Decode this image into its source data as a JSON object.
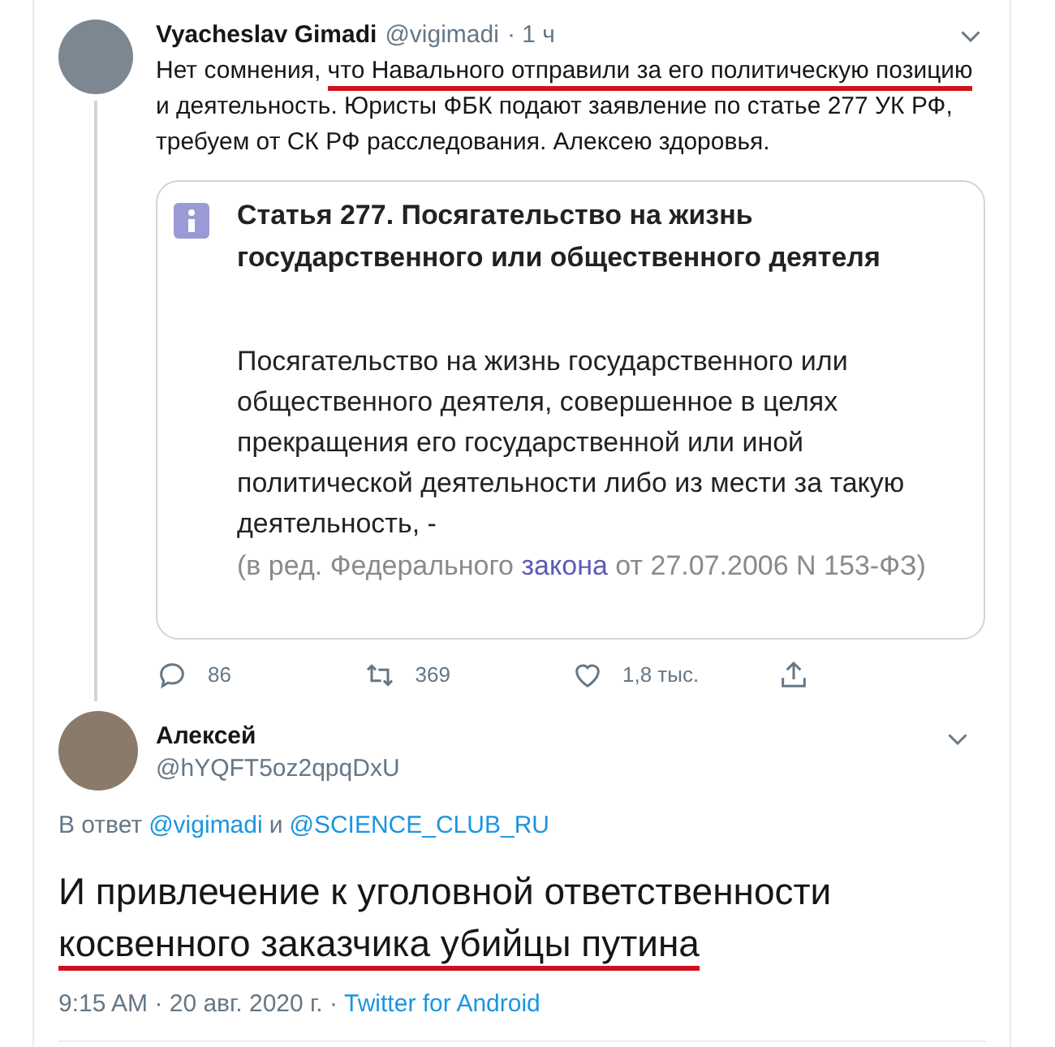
{
  "tweet": {
    "name": "Vyacheslav Gimadi",
    "handle": "@vigimadi",
    "time": "· 1 ч",
    "text": [
      {
        "text": "Нет сомнения, ",
        "underlined": false
      },
      {
        "text": "что Навального отправили за его политическую позицию",
        "underlined": true
      },
      {
        "text": " и деятельность. Юристы ФБК подают заявление по статье 277 УК РФ, требуем от СК РФ расследования. Алексею здоровья.",
        "underlined": false
      }
    ],
    "image": {
      "heading": "Статья 277. Посягательство на жизнь государственного или общественного деятеля",
      "body": "Посягательство на жизнь государственного или общественного деятеля, совершенное в целях прекращения его государственной или иной политической деятельности либо из мести за такую деятельность, -",
      "note_before": "(в ред. Федерального ",
      "note_link": "закона",
      "note_after": " от 27.07.2006 N 153-ФЗ)"
    },
    "actions": [
      {
        "kind": "reply",
        "count": "86"
      },
      {
        "kind": "retweet",
        "count": "369"
      },
      {
        "kind": "like",
        "count": "1,8 тыс."
      },
      {
        "kind": "share"
      }
    ]
  },
  "reply": {
    "name": "Алексей",
    "handle": "@hYQFT5oz2qpqDxU",
    "in_reply_label": "В ответ",
    "mentions": [
      "@vigimadi",
      "@SCIENCE_CLUB_RU"
    ],
    "joiner": "и",
    "text": [
      {
        "text": "И привлечение к уголовной ответственности ",
        "underlined": false
      },
      {
        "text": "косвенного заказчика убийцы путина",
        "underlined": true
      }
    ],
    "time": "9:15 AM · 20 авг. 2020 г. ·",
    "source": "Twitter for Android"
  }
}
